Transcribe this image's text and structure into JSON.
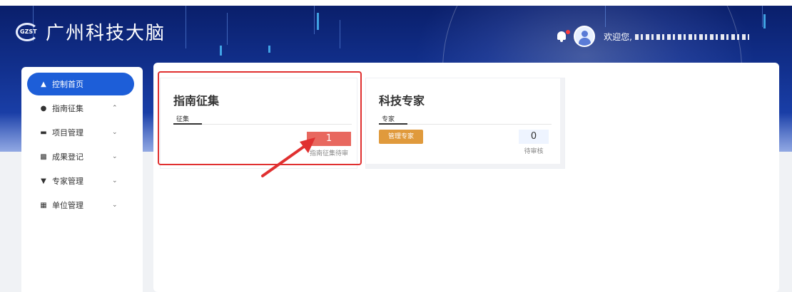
{
  "app": {
    "title": "广州科技大脑",
    "logo_text": "GZST"
  },
  "header": {
    "welcome": "欢迎您,"
  },
  "sidebar": {
    "items": [
      {
        "label": "控制首页",
        "icon": "home-icon",
        "active": true
      },
      {
        "label": "指南征集",
        "icon": "globe-icon",
        "expanded": true
      },
      {
        "label": "项目管理",
        "icon": "folder-icon"
      },
      {
        "label": "成果登记",
        "icon": "copy-icon"
      },
      {
        "label": "专家管理",
        "icon": "graduation-cap-icon"
      },
      {
        "label": "单位管理",
        "icon": "building-icon"
      }
    ]
  },
  "cards": [
    {
      "title": "指南征集",
      "tab": "征集",
      "stat": {
        "value": "1",
        "label": "指南征集待审"
      }
    },
    {
      "title": "科技专家",
      "tab": "专家",
      "button": "管理专家",
      "stat": {
        "value": "0",
        "label": "待审核"
      }
    }
  ],
  "colors": {
    "primary": "#1d5ed8",
    "alert": "#e8685f",
    "warning": "#e09a3c",
    "annotation": "#e03030"
  }
}
